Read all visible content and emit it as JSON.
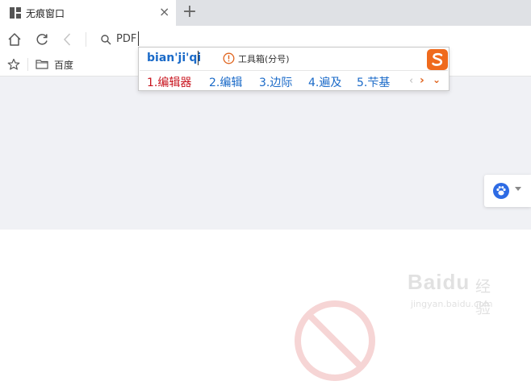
{
  "tabs": {
    "active_title": "无痕窗口",
    "close_symbol": "×",
    "new_tab_symbol": "+"
  },
  "toolbar": {
    "address_value": "PDF",
    "icons": [
      "home-icon",
      "refresh-icon",
      "back-icon",
      "search-icon"
    ]
  },
  "bookmarks": {
    "items": [
      {
        "label": "百度"
      }
    ]
  },
  "ime": {
    "pinyin": "bian'ji'qi",
    "tool_label": "工具箱(分号)",
    "candidates": [
      {
        "label": "1.编辑器"
      },
      {
        "label": "2.编辑"
      },
      {
        "label": "3.边际"
      },
      {
        "label": "4.遍及"
      },
      {
        "label": "5.芐基"
      }
    ],
    "prev_symbol": "‹",
    "next_symbol": "›",
    "expand_symbol": "⌄",
    "colors": {
      "first": "#c8141e",
      "other": "#1a6ac8",
      "accent": "#e0641e"
    }
  },
  "watermark": {
    "brand": "Baidu",
    "product": "经验",
    "url": "jingyan.baidu.com"
  }
}
